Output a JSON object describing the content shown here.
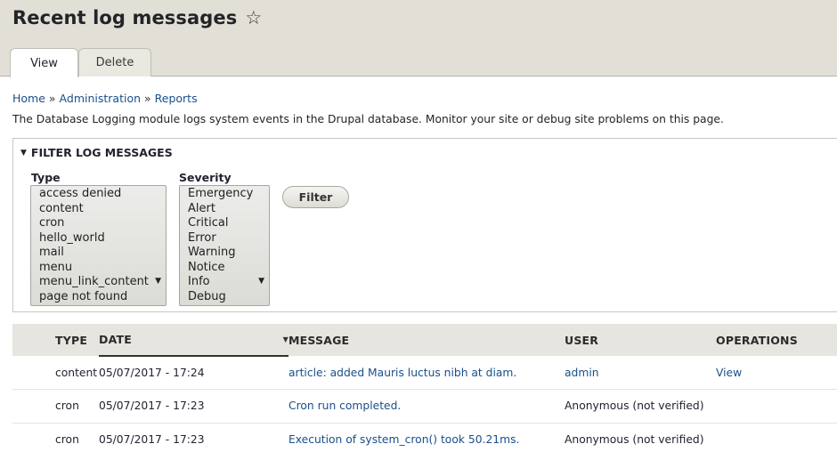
{
  "header": {
    "title": "Recent log messages",
    "star_glyph": "☆"
  },
  "tabs": [
    {
      "label": "View",
      "active": true
    },
    {
      "label": "Delete",
      "active": false
    }
  ],
  "breadcrumb": {
    "items": [
      "Home",
      "Administration",
      "Reports"
    ],
    "separator": "»"
  },
  "description": "The Database Logging module logs system events in the Drupal database. Monitor your site or debug site problems on this page.",
  "filter": {
    "legend": "FILTER LOG MESSAGES",
    "type_label": "Type",
    "type_options": [
      "access denied",
      "content",
      "cron",
      "hello_world",
      "mail",
      "menu",
      "menu_link_content",
      "page not found"
    ],
    "severity_label": "Severity",
    "severity_options": [
      "Emergency",
      "Alert",
      "Critical",
      "Error",
      "Warning",
      "Notice",
      "Info",
      "Debug"
    ],
    "button_label": "Filter"
  },
  "table": {
    "columns": [
      "Type",
      "Date",
      "Message",
      "User",
      "Operations"
    ],
    "sorted_column": "Date",
    "rows": [
      {
        "type": "content",
        "date": "05/07/2017 - 17:24",
        "message": "article: added Mauris luctus nibh at diam.",
        "user": "admin",
        "operations": "View"
      },
      {
        "type": "cron",
        "date": "05/07/2017 - 17:23",
        "message": "Cron run completed.",
        "user": "Anonymous (not verified)",
        "operations": ""
      },
      {
        "type": "cron",
        "date": "05/07/2017 - 17:23",
        "message": "Execution of system_cron() took 50.21ms.",
        "user": "Anonymous (not verified)",
        "operations": ""
      }
    ]
  },
  "colors": {
    "header_bg": "#e2e0d6",
    "link": "#1a4f8b",
    "table_header_bg": "#e6e5e0"
  }
}
